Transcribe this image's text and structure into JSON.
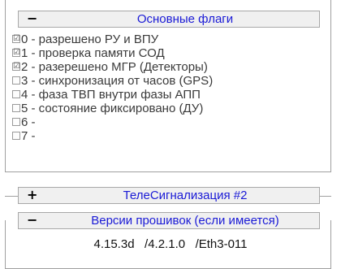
{
  "sections": {
    "main_flags": {
      "toggle": "−",
      "title": "Основные флаги"
    },
    "telesignal": {
      "toggle": "+",
      "title": "ТелеСигнализация #2"
    },
    "firmware": {
      "toggle": "−",
      "title": "Версии прошивок (если имеется)"
    }
  },
  "flags": [
    {
      "checked": true,
      "mark": "☑",
      "label": "0 - разрешено РУ и ВПУ"
    },
    {
      "checked": true,
      "mark": "☑",
      "label": "1 - проверка памяти СОД"
    },
    {
      "checked": true,
      "mark": "☑",
      "label": "2 - разерешено МГР (Детекторы)"
    },
    {
      "checked": false,
      "mark": "",
      "label": "3 - синхронизация от часов (GPS)"
    },
    {
      "checked": false,
      "mark": "",
      "label": "4 - фаза ТВП внутри фазы АПП"
    },
    {
      "checked": false,
      "mark": "",
      "label": "5 - состояние фиксировано (ДУ)"
    },
    {
      "checked": false,
      "mark": "",
      "label": "6 -"
    },
    {
      "checked": false,
      "mark": "",
      "label": "7 -"
    }
  ],
  "firmware_versions": "4.15.3d   /4.2.1.0   /Eth3-011",
  "colors": {
    "section_title": "#1a1ad6",
    "frame": "#a0a0a0",
    "header_bg": "#f0f0f0"
  }
}
